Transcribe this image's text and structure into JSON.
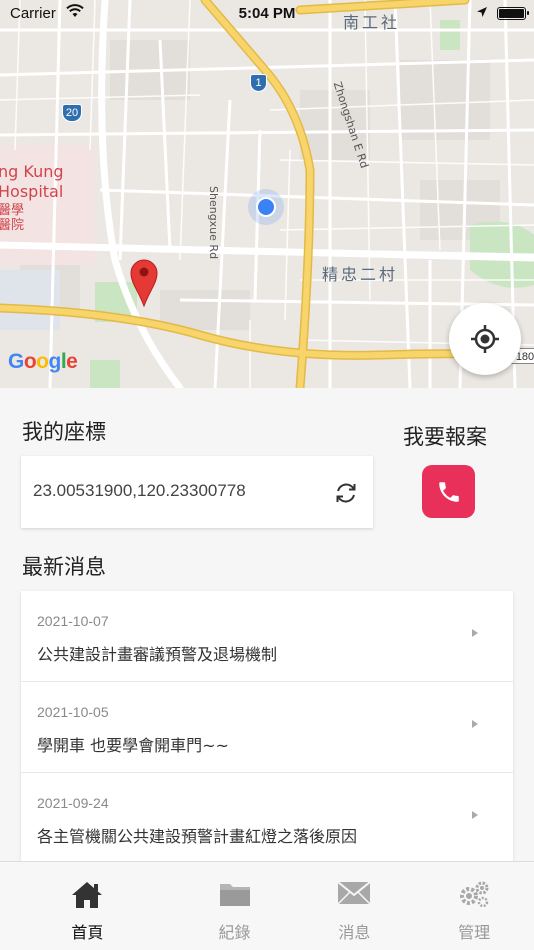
{
  "status_bar": {
    "carrier": "Carrier",
    "time": "5:04 PM"
  },
  "map": {
    "labels": {
      "nangong": "南工社",
      "jingzhong": "精忠二村",
      "hospital_en": "ng Kung\nHospital",
      "hospital_zh": "醫學\n醫院",
      "shengxue_rd": "Shengxue Rd",
      "zhongshan_rd": "Zhongshan E Rd"
    },
    "route_badges": {
      "r20": "20",
      "r1": "1",
      "r180": "180"
    },
    "provider_logo": "Google"
  },
  "coords": {
    "title": "我的座標",
    "value": "23.00531900,120.23300778"
  },
  "report": {
    "title": "我要報案"
  },
  "news": {
    "title": "最新消息",
    "items": [
      {
        "date": "2021-10-07",
        "text": "公共建設計畫審議預警及退場機制"
      },
      {
        "date": "2021-10-05",
        "text": "學開車 也要學會開車門~~"
      },
      {
        "date": "2021-09-24",
        "text": "各主管機關公共建設預警計畫紅燈之落後原因"
      }
    ]
  },
  "tabs": [
    {
      "label": "首頁",
      "icon": "home-icon",
      "active": true
    },
    {
      "label": "紀錄",
      "icon": "folder-icon",
      "active": false
    },
    {
      "label": "消息",
      "icon": "mail-icon",
      "active": false
    },
    {
      "label": "管理",
      "icon": "gears-icon",
      "active": false
    }
  ],
  "colors": {
    "accent": "#e8305a",
    "highway": "#f7d56a",
    "user_dot": "#3b82f6",
    "pin": "#e53935"
  }
}
